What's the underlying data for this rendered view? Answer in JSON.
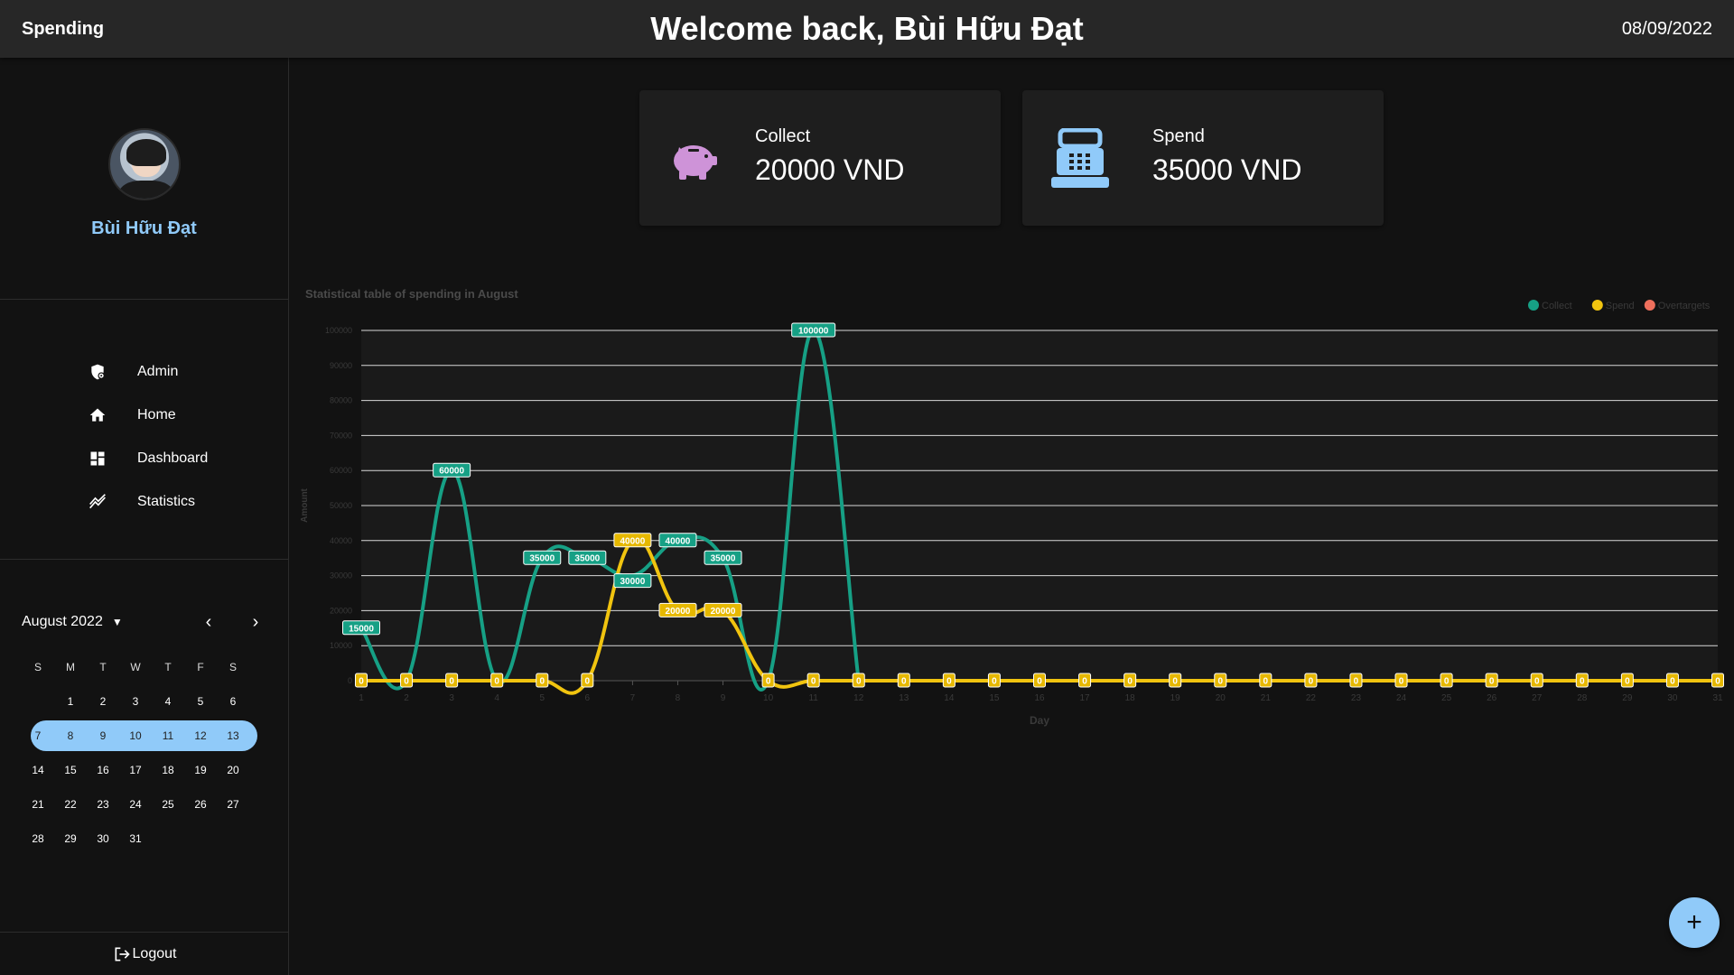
{
  "header": {
    "app_title": "Spending",
    "welcome": "Welcome back, Bùi Hữu Đạt",
    "date": "08/09/2022"
  },
  "profile": {
    "name": "Bùi Hữu Đạt"
  },
  "nav": [
    {
      "label": "Admin",
      "icon": "admin-shield-icon"
    },
    {
      "label": "Home",
      "icon": "home-icon"
    },
    {
      "label": "Dashboard",
      "icon": "dashboard-icon"
    },
    {
      "label": "Statistics",
      "icon": "statistics-icon"
    }
  ],
  "calendar": {
    "month_label": "August 2022",
    "weekdays": [
      "S",
      "M",
      "T",
      "W",
      "T",
      "F",
      "S"
    ],
    "weeks": [
      [
        "",
        "1",
        "2",
        "3",
        "4",
        "5",
        "6"
      ],
      [
        "7",
        "8",
        "9",
        "10",
        "11",
        "12",
        "13"
      ],
      [
        "14",
        "15",
        "16",
        "17",
        "18",
        "19",
        "20"
      ],
      [
        "21",
        "22",
        "23",
        "24",
        "25",
        "26",
        "27"
      ],
      [
        "28",
        "29",
        "30",
        "31",
        "",
        "",
        ""
      ]
    ],
    "selected_week_index": 1
  },
  "logout_label": "Logout",
  "cards": {
    "collect": {
      "label": "Collect",
      "value": "20000 VND",
      "icon": "piggy-bank-icon",
      "color": "#ce93d8"
    },
    "spend": {
      "label": "Spend",
      "value": "35000 VND",
      "icon": "cash-register-icon",
      "color": "#90caf9"
    }
  },
  "fab_label": "+",
  "chart_data": {
    "type": "line",
    "title": "Statistical table of spending in August",
    "xlabel": "Day",
    "ylabel": "Amount",
    "ylim": [
      0,
      100000
    ],
    "yticks": [
      0,
      10000,
      20000,
      30000,
      40000,
      50000,
      60000,
      70000,
      80000,
      90000,
      100000
    ],
    "categories": [
      "1",
      "2",
      "3",
      "4",
      "5",
      "6",
      "7",
      "8",
      "9",
      "10",
      "11",
      "12",
      "13",
      "14",
      "15",
      "16",
      "17",
      "18",
      "19",
      "20",
      "21",
      "22",
      "23",
      "24",
      "25",
      "26",
      "27",
      "28",
      "29",
      "30",
      "31"
    ],
    "legend_position": "top-right",
    "series": [
      {
        "name": "Collect",
        "color": "#16a085",
        "values": [
          15000,
          0,
          60000,
          0,
          35000,
          35000,
          30000,
          40000,
          35000,
          0,
          100000,
          0,
          null,
          null,
          null,
          null,
          null,
          null,
          null,
          null,
          null,
          null,
          null,
          null,
          null,
          null,
          null,
          null,
          null,
          null,
          null
        ]
      },
      {
        "name": "Spend",
        "color": "#f1c40f",
        "values": [
          0,
          0,
          0,
          0,
          0,
          0,
          40000,
          20000,
          20000,
          0,
          0,
          0,
          0,
          0,
          0,
          0,
          0,
          0,
          0,
          0,
          0,
          0,
          0,
          0,
          0,
          0,
          0,
          0,
          0,
          0,
          0
        ]
      },
      {
        "name": "Overtargets",
        "color": "#ef6f5c",
        "values": []
      }
    ]
  }
}
